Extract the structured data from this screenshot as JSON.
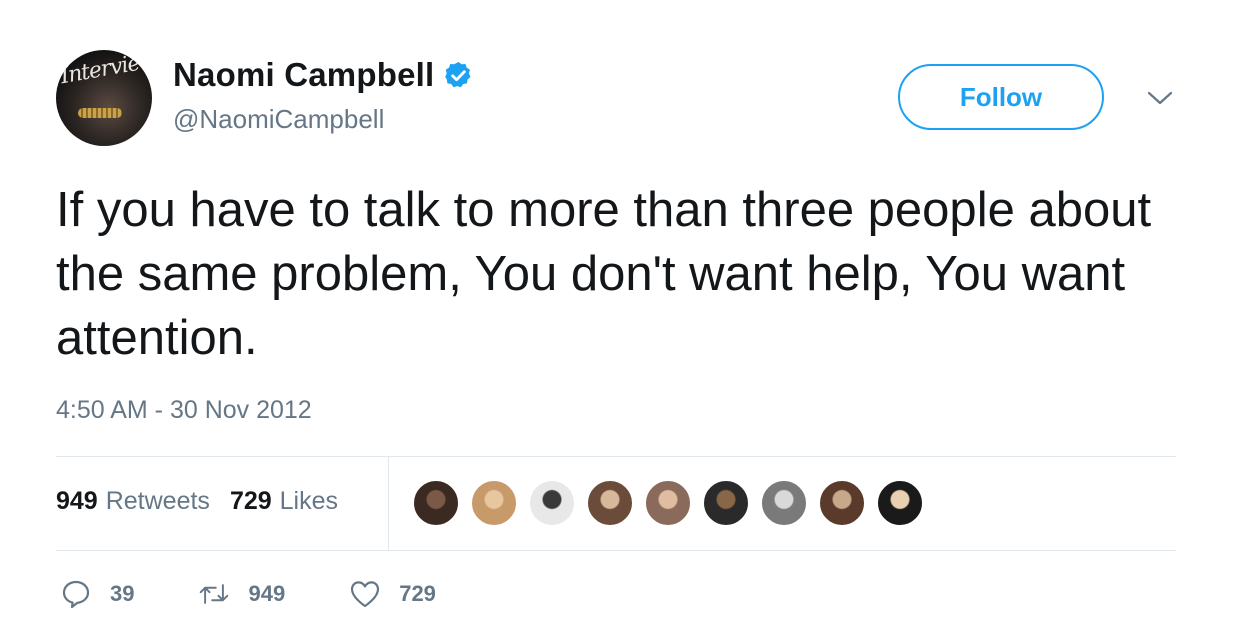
{
  "user": {
    "display_name": "Naomi Campbell",
    "handle": "@NaomiCampbell",
    "avatar_text": "Interview"
  },
  "follow_label": "Follow",
  "tweet": {
    "text": "If you have to talk to more than three people about the same problem, You don't want help, You want attention.",
    "timestamp": "4:50 AM - 30 Nov 2012"
  },
  "stats": {
    "retweets_count": "949",
    "retweets_label": "Retweets",
    "likes_count": "729",
    "likes_label": "Likes"
  },
  "actions": {
    "replies": "39",
    "retweets": "949",
    "likes": "729"
  },
  "colors": {
    "accent": "#1da1f2",
    "muted": "#657786",
    "divider": "#e1e8ed"
  },
  "liker_avatars": [
    {
      "bg": "#3b2a22",
      "fg": "#7a5a46"
    },
    {
      "bg": "#c89a6a",
      "fg": "#e6c7a0"
    },
    {
      "bg": "#e8e8e8",
      "fg": "#3a3a3a"
    },
    {
      "bg": "#6b4b3a",
      "fg": "#d8b89a"
    },
    {
      "bg": "#8a6a5a",
      "fg": "#e0bca0"
    },
    {
      "bg": "#2a2a2a",
      "fg": "#8a6648"
    },
    {
      "bg": "#7a7a7a",
      "fg": "#d9d9d9"
    },
    {
      "bg": "#5a3a2a",
      "fg": "#c8a88a"
    },
    {
      "bg": "#1a1a1a",
      "fg": "#e8d0b0"
    }
  ]
}
